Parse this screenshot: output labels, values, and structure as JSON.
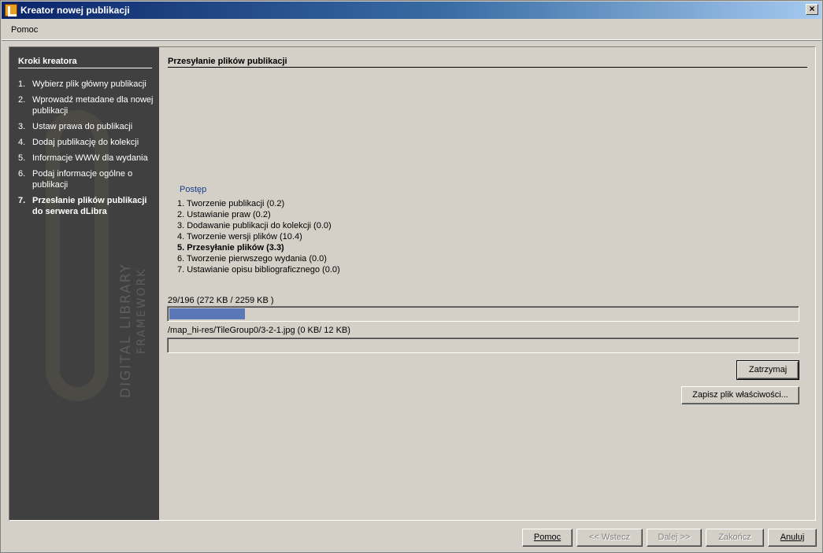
{
  "window": {
    "title": "Kreator nowej publikacji",
    "close_glyph": "×"
  },
  "menu": {
    "help": "Pomoc"
  },
  "sidebar": {
    "heading": "Kroki kreatora",
    "watermark_line1": "DIGITAL LIBRARY",
    "watermark_line2": "FRAMEWORK",
    "steps": [
      {
        "num": "1.",
        "label": "Wybierz plik główny publikacji"
      },
      {
        "num": "2.",
        "label": "Wprowadź metadane dla nowej publikacji"
      },
      {
        "num": "3.",
        "label": "Ustaw prawa do publikacji"
      },
      {
        "num": "4.",
        "label": "Dodaj publikację do kolekcji"
      },
      {
        "num": "5.",
        "label": "Informacje WWW dla wydania"
      },
      {
        "num": "6.",
        "label": "Podaj informacje ogólne o publikacji"
      },
      {
        "num": "7.",
        "label": "Przesłanie plików publikacji do serwera dLibra"
      }
    ],
    "active_step": 7
  },
  "main": {
    "heading": "Przesyłanie plików publikacji",
    "progress_title": "Postęp",
    "progress_items": [
      "1. Tworzenie publikacji (0.2)",
      "2. Ustawianie praw (0.2)",
      "3. Dodawanie publikacji do kolekcji (0.0)",
      "4. Tworzenie wersji plików (10.4)",
      "5. Przesyłanie plików (3.3)",
      "6. Tworzenie pierwszego wydania (0.0)",
      "7. Ustawianie opisu bibliograficznego (0.0)"
    ],
    "current_item": 5,
    "overall": {
      "label": "29/196  (272 KB / 2259 KB )",
      "progress": 0.12
    },
    "file": {
      "label": "/map_hi-res/TileGroup0/3-2-1.jpg  (0 KB/ 12 KB)",
      "progress": 0.0
    },
    "pause_button": "Zatrzymaj",
    "save_props_button": "Zapisz plik właściwości..."
  },
  "footer": {
    "help": "Pomoc",
    "back": "<< Wstecz",
    "next": "Dalej >>",
    "finish": "Zakończ",
    "cancel": "Anuluj"
  },
  "colors": {
    "titlebar": "#0a246a",
    "sidebar": "#404040",
    "progress_fill": "#5a77b8",
    "progress_title": "#1a3b8a"
  }
}
